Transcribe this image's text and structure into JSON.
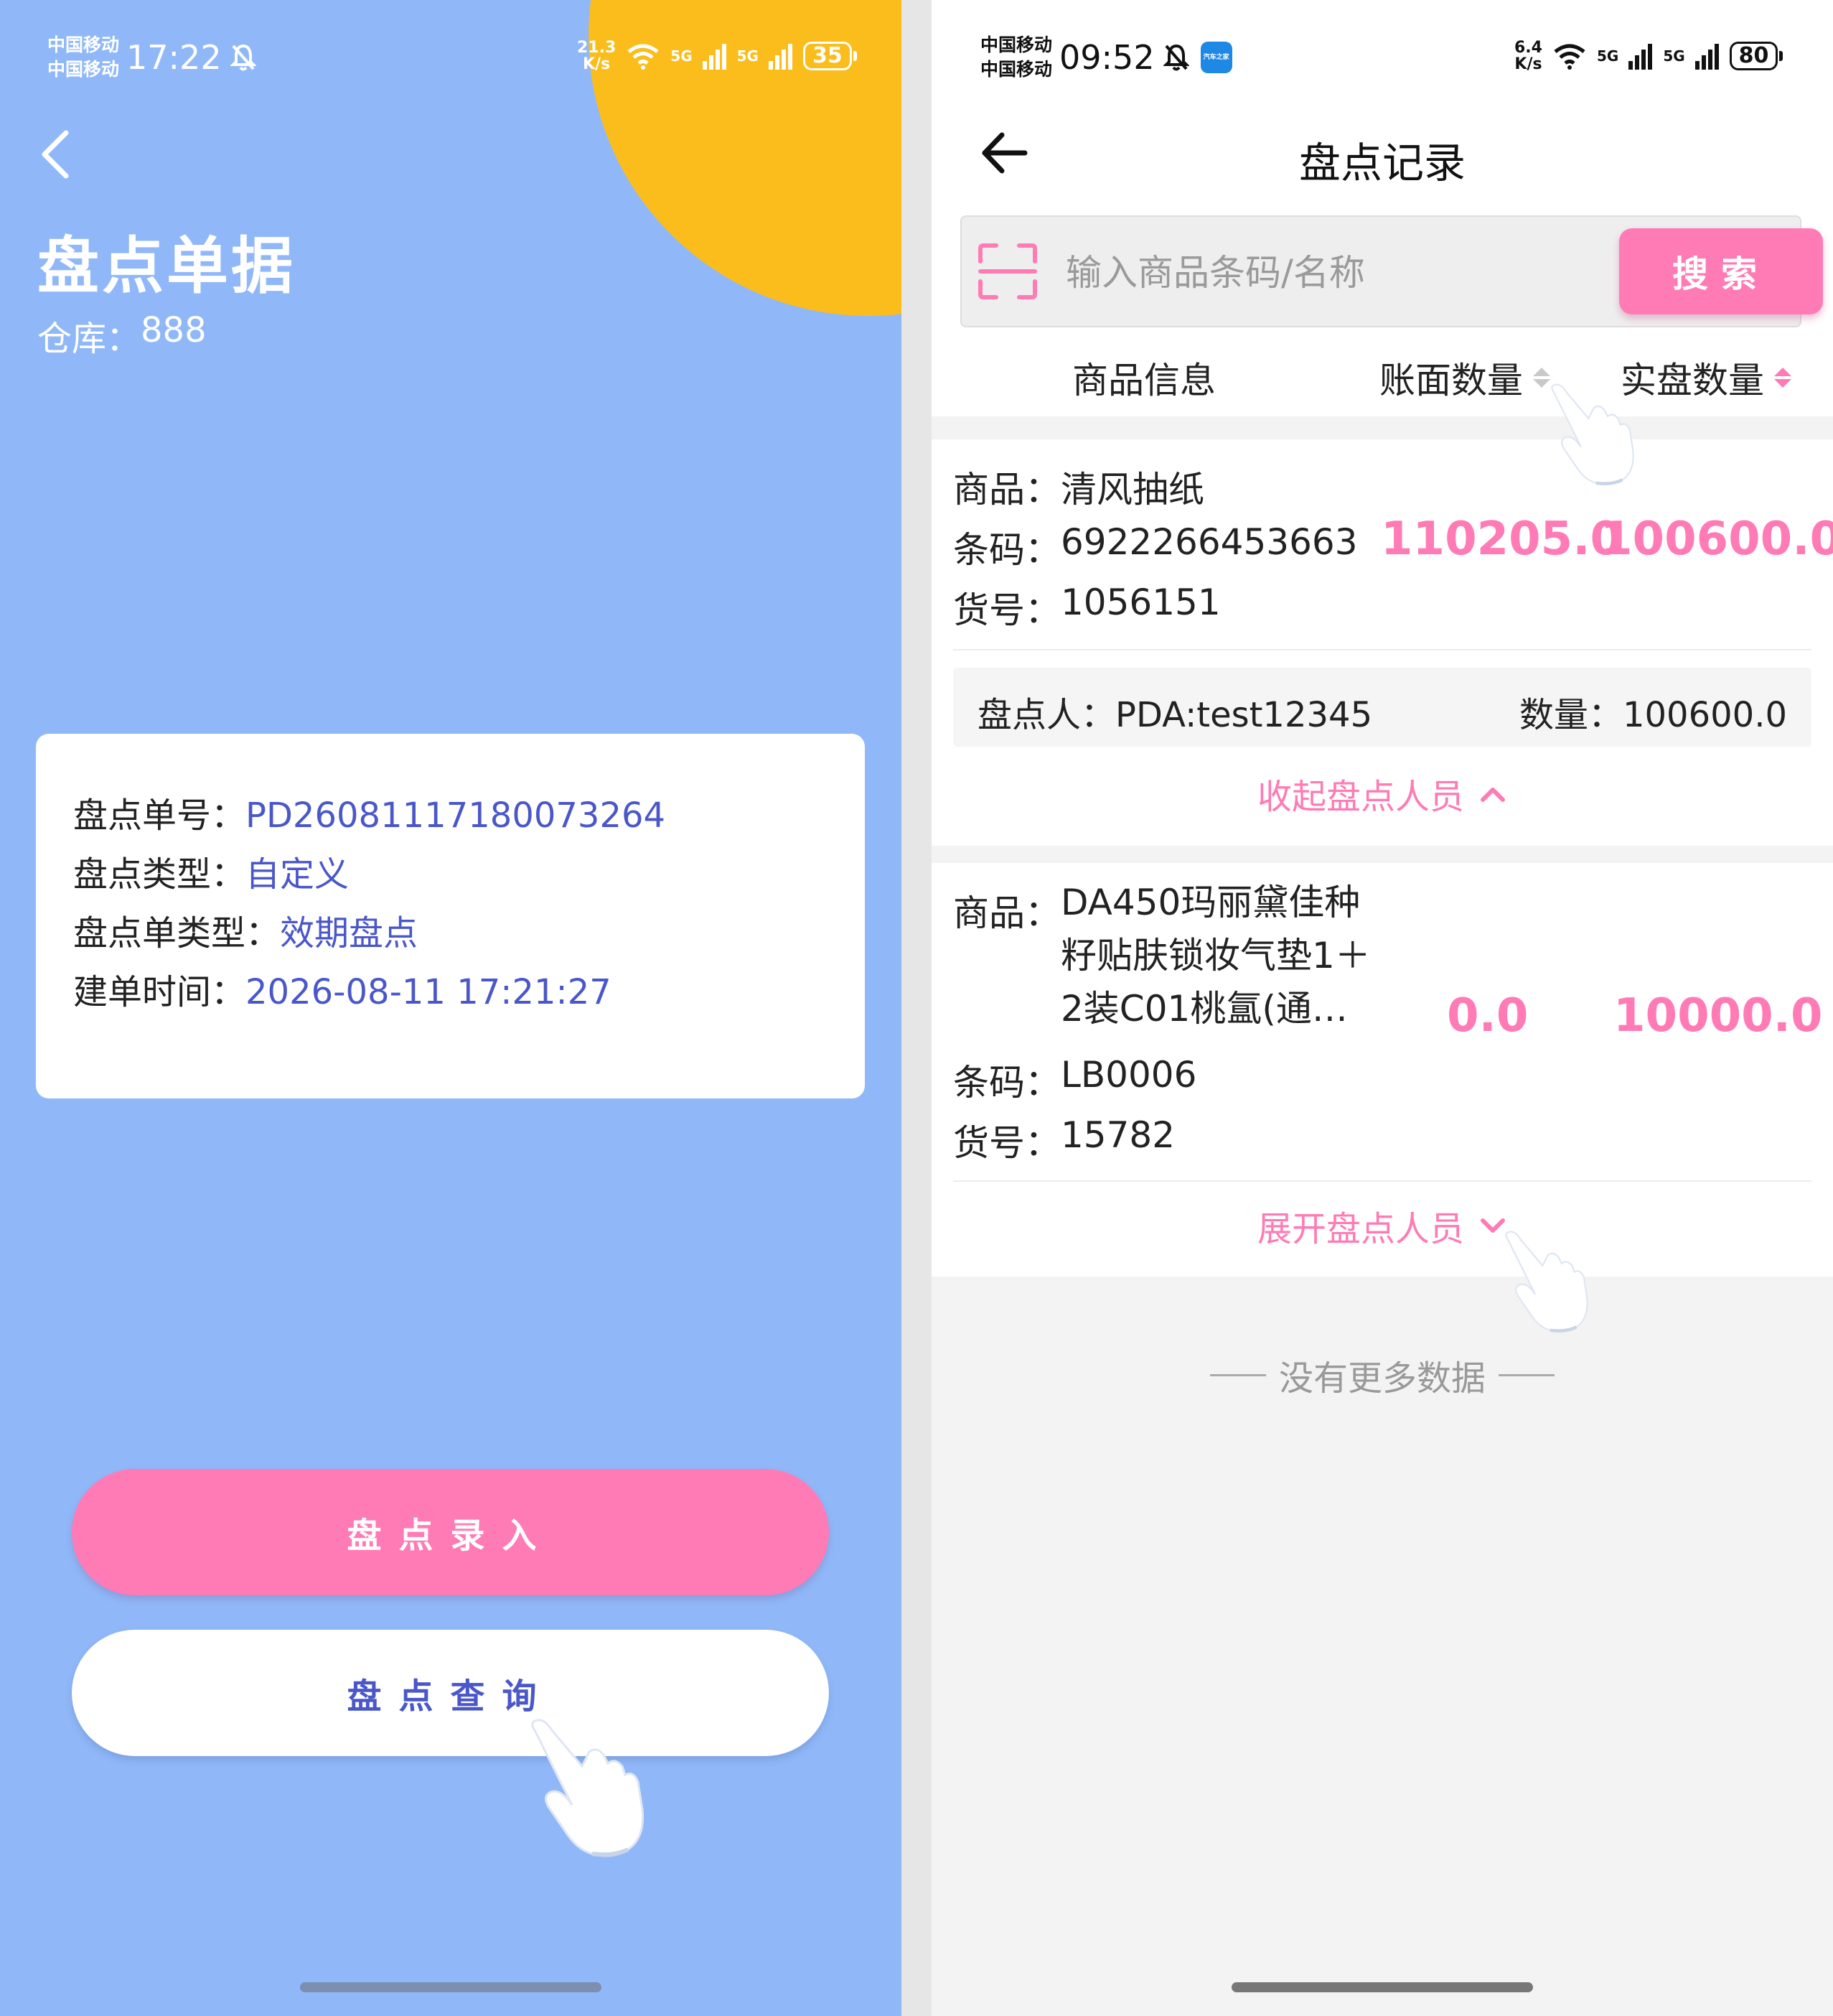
{
  "left": {
    "status": {
      "carrier1": "中国移动",
      "carrier2": "中国移动",
      "time": "17:22",
      "speed_value": "21.3",
      "speed_unit": "K/s",
      "net1": "5G",
      "net2": "5G",
      "battery": "35"
    },
    "title": "盘点单据",
    "warehouse_label": "仓库：",
    "warehouse_value": "888",
    "info": [
      {
        "label": "盘点单号：",
        "value": "PD26081117180073264"
      },
      {
        "label": "盘点类型：",
        "value": "自定义"
      },
      {
        "label": "盘点单类型：",
        "value": "效期盘点"
      },
      {
        "label": "建单时间：",
        "value": "2026-08-11 17:21:27"
      }
    ],
    "btn_entry": "盘点录入",
    "btn_query": "盘点查询"
  },
  "right": {
    "status": {
      "carrier1": "中国移动",
      "carrier2": "中国移动",
      "time": "09:52",
      "speed_value": "6.4",
      "speed_unit": "K/s",
      "net1": "5G",
      "net2": "5G",
      "battery": "80",
      "app_badge": "汽车之家"
    },
    "title": "盘点记录",
    "search_placeholder": "输入商品条码/名称",
    "search_button": "搜索",
    "columns": [
      "商品信息",
      "账面数量",
      "实盘数量"
    ],
    "records": [
      {
        "product_label": "商品：",
        "product": "清风抽纸",
        "barcode_label": "条码：",
        "barcode": "6922266453663",
        "sku_label": "货号：",
        "sku": "1056151",
        "book_qty": "110205.0",
        "actual_qty": "100600.0",
        "counter_label": "盘点人：",
        "counter": "PDA:test12345",
        "qty_label": "数量：",
        "qty": "100600.0",
        "toggle": "收起盘点人员"
      },
      {
        "product_label": "商品：",
        "product_lines": [
          "DA450玛丽黛佳种",
          "籽贴肤锁妆气垫1＋",
          "2装C01桃氲(通…"
        ],
        "barcode_label": "条码：",
        "barcode": "LB0006",
        "sku_label": "货号：",
        "sku": "15782",
        "book_qty": "0.0",
        "actual_qty": "10000.0",
        "toggle": "展开盘点人员"
      }
    ],
    "no_more": "没有更多数据"
  },
  "colors": {
    "left_bg": "#90b8f8",
    "accent_yellow": "#fbbd1c",
    "pink": "#ff7bb5",
    "indigo": "#4a57c9"
  },
  "icons": [
    "back-chevron-icon",
    "bell-mute-icon",
    "wifi-icon",
    "signal-icon",
    "battery-icon",
    "back-arrow-icon",
    "scan-icon",
    "sort-icon",
    "chevron-up-icon",
    "chevron-down-icon",
    "hand-pointer-icon"
  ]
}
